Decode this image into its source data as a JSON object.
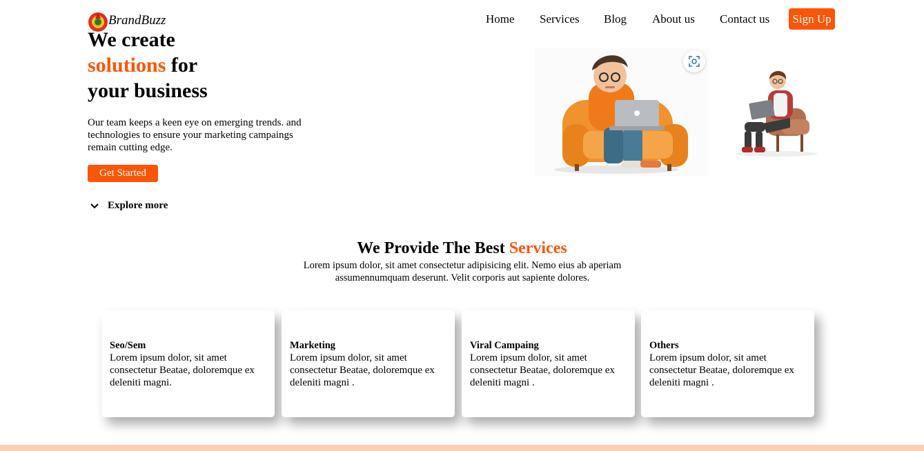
{
  "nav": {
    "brand": "BrandBuzz",
    "links": [
      "Home",
      "Services",
      "Blog",
      "About us",
      "Contact us"
    ],
    "signup_label": "Sign Up"
  },
  "hero": {
    "title_line1": "We create",
    "title_accent": "solutions",
    "title_line2_rest": " for",
    "title_line3": "your business",
    "description": "Our team keeps a keen eye on emerging trends. and technologies to ensure your marketing campaings remain cutting edge.",
    "cta_label": "Get Started",
    "explore_label": "Explore more"
  },
  "services": {
    "title_main": "We Provide The Best ",
    "title_accent": "Services",
    "subtitle": "Lorem ipsum dolor, sit amet consectetur adipisicing elit. Nemo eius ab aperiam assumennumquam deserunt. Velit corporis aut sapiente dolores.",
    "cards": [
      {
        "title": "Seo/Sem",
        "text": "Lorem ipsum dolor, sit amet consectetur Beatae, doloremque ex deleniti magni."
      },
      {
        "title": "Marketing",
        "text": "Lorem ipsum dolor, sit amet consectetur Beatae, doloremque ex deleniti magni ."
      },
      {
        "title": "Viral Campaing",
        "text": "Lorem ipsum dolor, sit amet consectetur Beatae, doloremque ex deleniti magni ."
      },
      {
        "title": "Others",
        "text": "Lorem ipsum dolor, sit amet consectetur Beatae, doloremque ex deleniti magni ."
      }
    ]
  },
  "colors": {
    "accent": "#fb5508",
    "footer_strip": "#ffcdb0"
  },
  "icons": {
    "logo": "brand-logo-icon",
    "explore": "chevron-down-icon",
    "scan": "visual-search-icon"
  }
}
